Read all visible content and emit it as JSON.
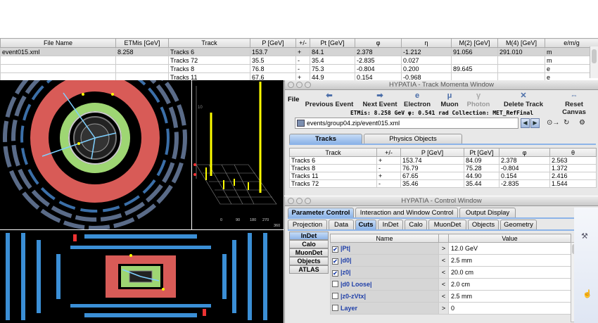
{
  "top_table": {
    "headers": [
      "File Name",
      "ETMis [GeV]",
      "Track",
      "P [GeV]",
      "+/-",
      "Pt [GeV]",
      "φ",
      "η",
      "M(2) [GeV]",
      "M(4) [GeV]",
      "e/m/g"
    ],
    "rows": [
      [
        "event015.xml",
        "8.258",
        "Tracks 6",
        "153.7",
        "+",
        "84.1",
        "2.378",
        "-1.212",
        "91.056",
        "291.010",
        "m"
      ],
      [
        "",
        "",
        "Tracks 72",
        "35.5",
        "-",
        "35.4",
        "-2.835",
        "0.027",
        "",
        "",
        "m"
      ],
      [
        "",
        "",
        "Tracks 8",
        "76.8",
        "-",
        "75.3",
        "-0.804",
        "0.200",
        "89.645",
        "",
        "e"
      ],
      [
        "",
        "",
        "Tracks 11",
        "67.6",
        "+",
        "44.9",
        "0.154",
        "-0.968",
        "",
        "",
        "e"
      ]
    ]
  },
  "lego": {
    "axis_label_10": "10",
    "x_ticks": [
      "0",
      "90",
      "180",
      "270",
      "360"
    ]
  },
  "track_window": {
    "title": "HYPATIA - Track Momenta Window",
    "menu": "File",
    "toolbar": [
      {
        "label": "Previous Event",
        "icon": "arrow-left-icon",
        "enabled": true
      },
      {
        "label": "Next Event",
        "icon": "arrow-right-icon",
        "enabled": true
      },
      {
        "label": "Electron",
        "icon": "electron-icon",
        "enabled": true
      },
      {
        "label": "Muon",
        "icon": "muon-icon",
        "enabled": true
      },
      {
        "label": "Photon",
        "icon": "photon-icon",
        "enabled": false
      },
      {
        "label": "Delete Track",
        "icon": "delete-icon",
        "enabled": true
      },
      {
        "label": "Reset Canvas",
        "icon": "reset-icon",
        "enabled": true
      }
    ],
    "info": "ETMis: 8.258 GeV    φ: 0.541 rad    Collection: MET_RefFinal",
    "path": "events/group04.zip/event015.xml",
    "tabs": [
      "Tracks",
      "Physics Objects"
    ],
    "headers": [
      "Track",
      "+/-",
      "P [GeV]",
      "Pt [GeV]",
      "φ",
      "θ"
    ],
    "rows": [
      [
        "Tracks 6",
        "+",
        "153.74",
        "84.09",
        "2.378",
        "2.563"
      ],
      [
        "Tracks 8",
        "-",
        "76.79",
        "75.28",
        "-0.804",
        "1.372"
      ],
      [
        "Tracks 11",
        "+",
        "67.65",
        "44.90",
        "0.154",
        "2.416"
      ],
      [
        "Tracks 72",
        "-",
        "35.46",
        "35.44",
        "-2.835",
        "1.544"
      ]
    ]
  },
  "control_window": {
    "title": "HYPATIA - Control Window",
    "tabs1": [
      "Parameter Control",
      "Interaction and Window Control",
      "Output Display"
    ],
    "tabs2": [
      "Projection",
      "Data",
      "Cuts",
      "InDet",
      "Calo",
      "MuonDet",
      "Objects",
      "Geometry"
    ],
    "side_tabs": [
      "InDet",
      "Calo",
      "MuonDet",
      "Objects",
      "ATLAS"
    ],
    "headers": [
      "Name",
      "Value"
    ],
    "cuts": [
      {
        "name": "|Pt|",
        "checked": true,
        "op": ">",
        "value": "12.0 GeV"
      },
      {
        "name": "|d0|",
        "checked": true,
        "op": "<",
        "value": "2.5 mm"
      },
      {
        "name": "|z0|",
        "checked": true,
        "op": "<",
        "value": "20.0 cm"
      },
      {
        "name": "|d0 Loose|",
        "checked": false,
        "op": "<",
        "value": "2.0 cm"
      },
      {
        "name": "|z0-zVtx|",
        "checked": false,
        "op": "<",
        "value": "2.5 mm"
      },
      {
        "name": "Layer",
        "checked": false,
        "op": ">",
        "value": "0"
      }
    ]
  },
  "colors": {
    "accent": "#8db4e8",
    "calo_red": "#e0605a",
    "calo_green": "#a6e07a",
    "muon_blue": "#3b8fd6"
  }
}
